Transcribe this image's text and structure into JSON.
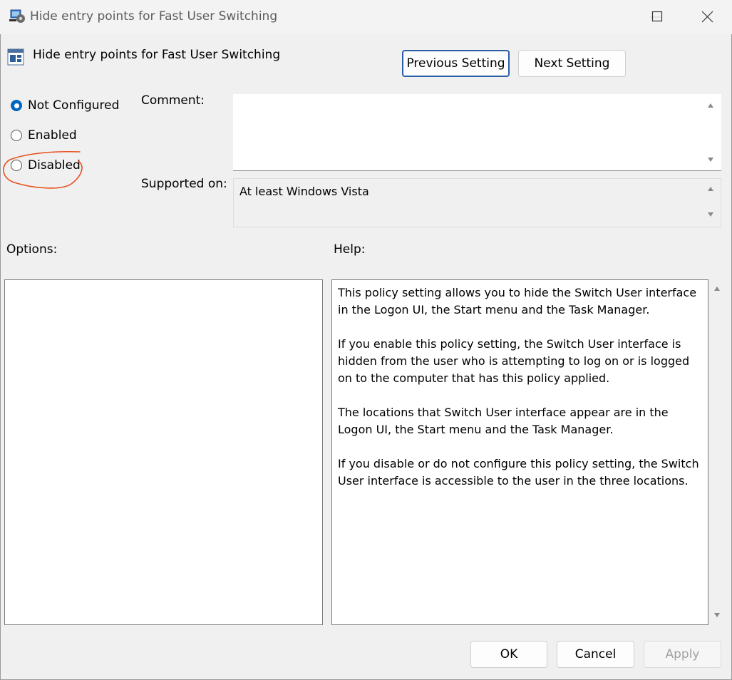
{
  "window": {
    "title": "Hide entry points for Fast User Switching",
    "minimize_icon": "minimize-icon",
    "maximize_icon": "maximize-icon",
    "close_icon": "close-icon"
  },
  "header": {
    "policy_title": "Hide entry points for Fast User Switching",
    "previous_setting_label": "Previous Setting",
    "next_setting_label": "Next Setting"
  },
  "state": {
    "options": [
      {
        "label": "Not Configured",
        "checked": true
      },
      {
        "label": "Enabled",
        "checked": false
      },
      {
        "label": "Disabled",
        "checked": false
      }
    ]
  },
  "fields": {
    "comment_label": "Comment:",
    "comment_value": "",
    "supported_on_label": "Supported on:",
    "supported_on_value": "At least Windows Vista"
  },
  "sections": {
    "options_label": "Options:",
    "help_label": "Help:"
  },
  "help": {
    "paragraphs": [
      "This policy setting allows you to hide the Switch User interface in the Logon UI, the Start menu and the Task Manager.",
      "If you enable this policy setting, the Switch User interface is hidden from the user who is attempting to log on or is logged on to the computer that has this policy applied.",
      "The locations that Switch User interface appear are in the Logon UI, the Start menu and the Task Manager.",
      "If you disable or do not configure this policy setting, the Switch User interface is accessible to the user in the three locations."
    ]
  },
  "footer": {
    "ok_label": "OK",
    "cancel_label": "Cancel",
    "apply_label": "Apply"
  },
  "colors": {
    "accent": "#0067c0",
    "annotation": "#e8501e"
  }
}
